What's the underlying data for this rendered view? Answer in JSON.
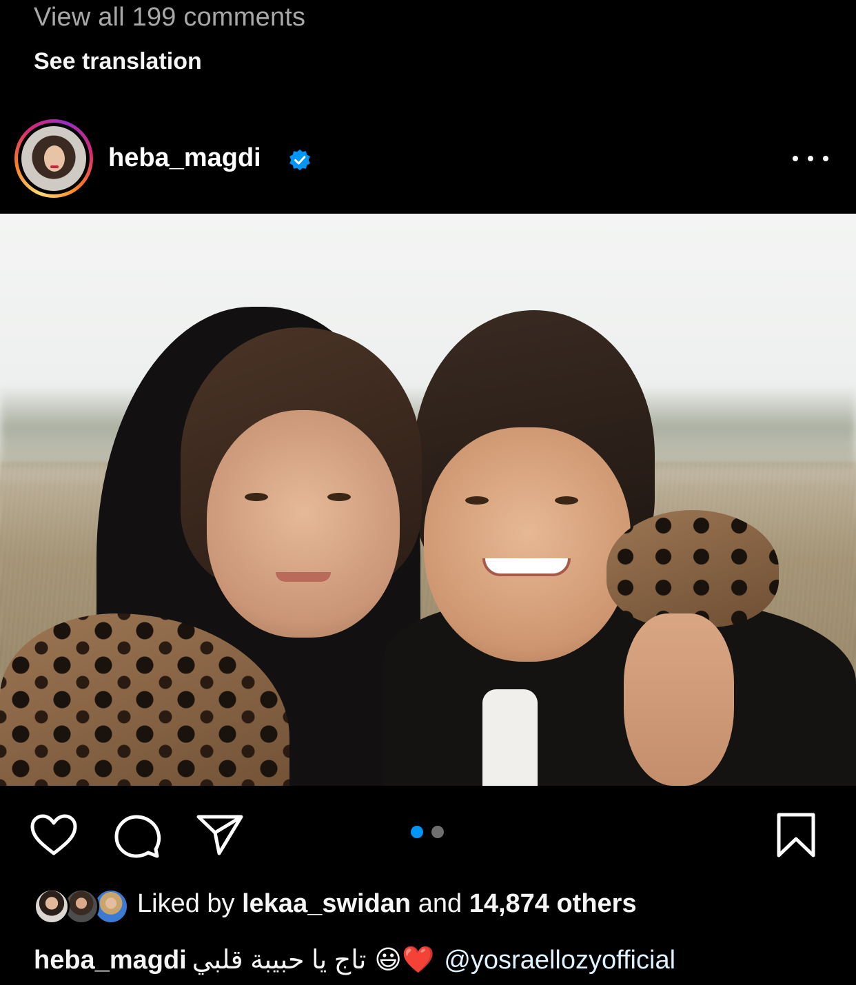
{
  "comments": {
    "view_all": "View all 199 comments",
    "see_translation": "See translation"
  },
  "post": {
    "username": "heba_magdi",
    "verified_icon": "verified-badge-icon",
    "more_icon": "more-options-icon"
  },
  "actions": {
    "like_icon": "heart-icon",
    "comment_icon": "comment-icon",
    "share_icon": "paper-plane-icon",
    "save_icon": "bookmark-icon",
    "carousel": {
      "total": 2,
      "active_index": 1
    }
  },
  "likes": {
    "prefix": "Liked by",
    "liker": "lekaa_swidan",
    "middle": "and",
    "count": "14,874 others"
  },
  "caption": {
    "username": "heba_magdi",
    "arabic_text": "تاج يا حبيبة قلبي",
    "emojis": "😃❤️",
    "mention": "@yosraellozyofficial"
  },
  "colors": {
    "background": "#000000",
    "accent_blue": "#0095f6",
    "muted_text": "#a8a8a8"
  }
}
